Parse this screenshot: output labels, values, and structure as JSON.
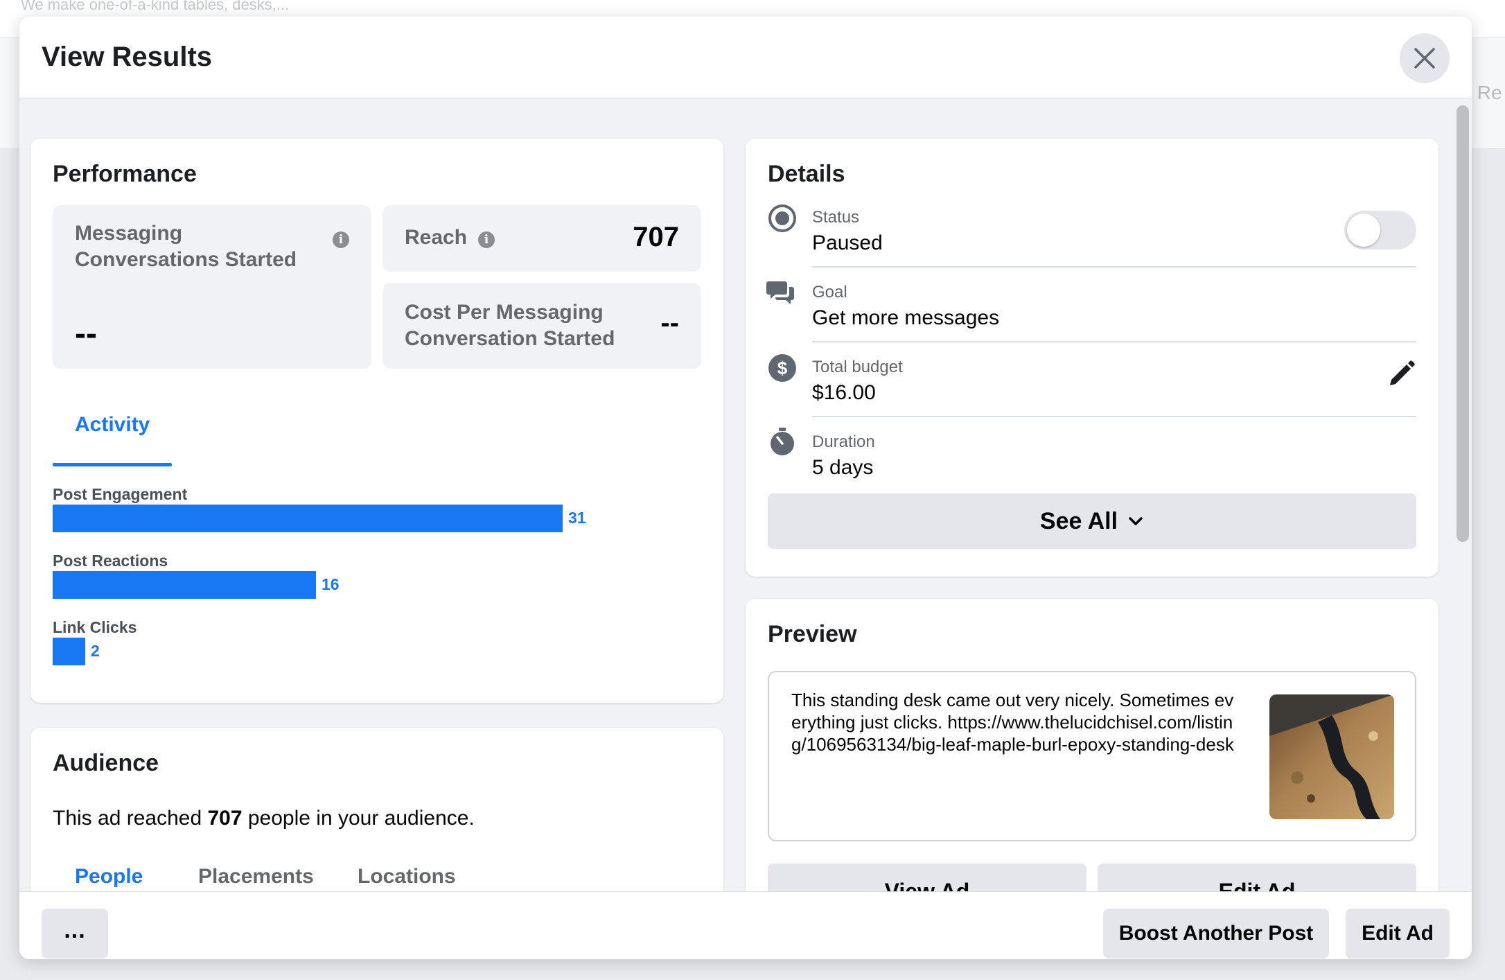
{
  "background": {
    "top_text": "We make one-of-a-kind tables, desks,...",
    "right_text": "v Re"
  },
  "modal": {
    "title": "View Results",
    "close_icon": "close-icon"
  },
  "performance": {
    "title": "Performance",
    "metrics": [
      {
        "label": "Messaging Conversations Started",
        "value": "--"
      },
      {
        "label": "Reach",
        "value": "707"
      },
      {
        "label": "Cost Per Messaging Conversation Started",
        "value": "--"
      }
    ],
    "tab": "Activity"
  },
  "chart_data": {
    "type": "bar",
    "orientation": "horizontal",
    "categories": [
      "Post Engagement",
      "Post Reactions",
      "Link Clicks"
    ],
    "values": [
      31,
      16,
      2
    ],
    "color": "#1877f2"
  },
  "audience": {
    "title": "Audience",
    "sentence_prefix": "This ad reached ",
    "reach": "707",
    "sentence_suffix": " people in your audience.",
    "tabs": [
      "People",
      "Placements",
      "Locations"
    ]
  },
  "details": {
    "title": "Details",
    "items": [
      {
        "label": "Status",
        "value": "Paused",
        "icon": "status-radio-icon"
      },
      {
        "label": "Goal",
        "value": "Get more messages",
        "icon": "chat-bubbles-icon"
      },
      {
        "label": "Total budget",
        "value": "$16.00",
        "icon": "dollar-icon"
      },
      {
        "label": "Duration",
        "value": "5 days",
        "icon": "stopwatch-icon"
      }
    ],
    "status_toggle_on": false,
    "see_all": "See All"
  },
  "preview": {
    "title": "Preview",
    "text": "This standing desk came out very nicely. Sometimes everything just clicks. https://www.thelucidchisel.com/listing/1069563134/big-leaf-maple-burl-epoxy-standing-desk",
    "view_ad": "View Ad",
    "edit_ad": "Edit Ad"
  },
  "footer": {
    "more": "...",
    "boost": "Boost Another Post",
    "edit_ad": "Edit Ad"
  },
  "colors": {
    "accent": "#1877f2",
    "surface": "#f0f2f5",
    "button": "#e4e6eb"
  }
}
